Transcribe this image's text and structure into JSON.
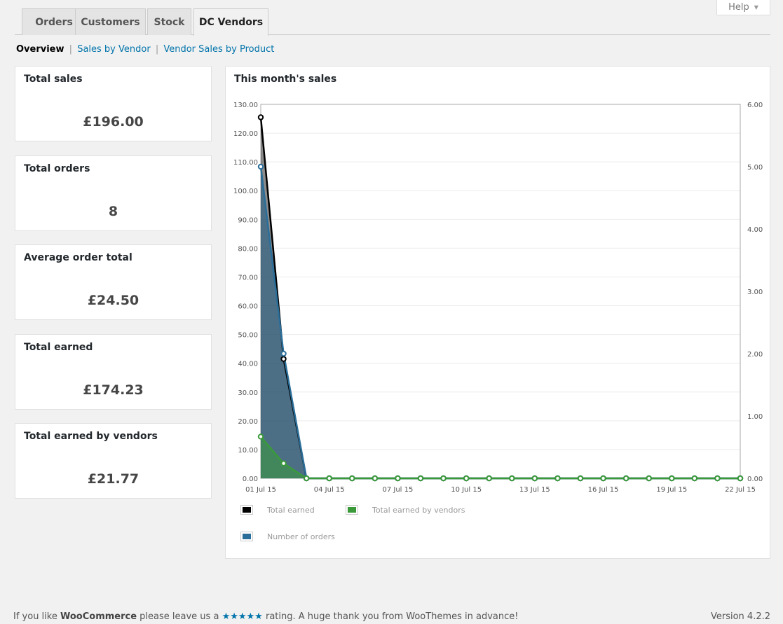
{
  "help": {
    "label": "Help"
  },
  "tabs": [
    {
      "label": "Orders"
    },
    {
      "label": "Customers"
    },
    {
      "label": "Stock"
    },
    {
      "label": "DC Vendors"
    }
  ],
  "subnav": {
    "overview": "Overview",
    "sales_by_vendor": "Sales by Vendor",
    "vendor_sales_by_product": "Vendor Sales by Product",
    "separator": "|"
  },
  "cards": [
    {
      "label": "Total sales",
      "value": "£196.00"
    },
    {
      "label": "Total orders",
      "value": "8"
    },
    {
      "label": "Average order total",
      "value": "£24.50"
    },
    {
      "label": "Total earned",
      "value": "£174.23"
    },
    {
      "label": "Total earned by vendors",
      "value": "£21.77"
    }
  ],
  "chart_panel": {
    "title": "This month's sales"
  },
  "colors": {
    "total_earned": "#000000",
    "total_earned_by_vendors": "#3a9a3a",
    "number_of_orders": "#2b6e99"
  },
  "chart_data": {
    "type": "line",
    "title": "This month's sales",
    "x": [
      "01 Jul 15",
      "02 Jul 15",
      "03 Jul 15",
      "04 Jul 15",
      "05 Jul 15",
      "06 Jul 15",
      "07 Jul 15",
      "08 Jul 15",
      "09 Jul 15",
      "10 Jul 15",
      "11 Jul 15",
      "12 Jul 15",
      "13 Jul 15",
      "14 Jul 15",
      "15 Jul 15",
      "16 Jul 15",
      "17 Jul 15",
      "18 Jul 15",
      "19 Jul 15",
      "20 Jul 15",
      "21 Jul 15",
      "22 Jul 15"
    ],
    "x_tick_labels": [
      "01 Jul 15",
      "04 Jul 15",
      "07 Jul 15",
      "10 Jul 15",
      "13 Jul 15",
      "16 Jul 15",
      "19 Jul 15",
      "22 Jul 15"
    ],
    "y_left_ticks": [
      "0.00",
      "10.00",
      "20.00",
      "30.00",
      "40.00",
      "50.00",
      "60.00",
      "70.00",
      "80.00",
      "90.00",
      "100.00",
      "110.00",
      "120.00",
      "130.00"
    ],
    "y_right_ticks": [
      "0.00",
      "1.00",
      "2.00",
      "3.00",
      "4.00",
      "5.00",
      "6.00"
    ],
    "ylim_left": [
      0,
      130
    ],
    "ylim_right": [
      0,
      6
    ],
    "grid": true,
    "legend_position": "bottom",
    "series": [
      {
        "name": "Total earned",
        "axis": "left",
        "values": [
          125.5,
          41.5,
          0,
          0,
          0,
          0,
          0,
          0,
          0,
          0,
          0,
          0,
          0,
          0,
          0,
          0,
          0,
          0,
          0,
          0,
          0,
          0
        ]
      },
      {
        "name": "Total earned by vendors",
        "axis": "left",
        "values": [
          14.5,
          5.2,
          0,
          0,
          0,
          0,
          0,
          0,
          0,
          0,
          0,
          0,
          0,
          0,
          0,
          0,
          0,
          0,
          0,
          0,
          0,
          0
        ]
      },
      {
        "name": "Number of orders",
        "axis": "right",
        "values": [
          5,
          2,
          0,
          0,
          0,
          0,
          0,
          0,
          0,
          0,
          0,
          0,
          0,
          0,
          0,
          0,
          0,
          0,
          0,
          0,
          0,
          0
        ]
      }
    ]
  },
  "footer": {
    "text_before": "If you like ",
    "brand": "WooCommerce",
    "text_middle": " please leave us a ",
    "stars": "★★★★★",
    "text_after": " rating. A huge thank you from WooThemes in advance!",
    "version": "Version 4.2.2"
  }
}
